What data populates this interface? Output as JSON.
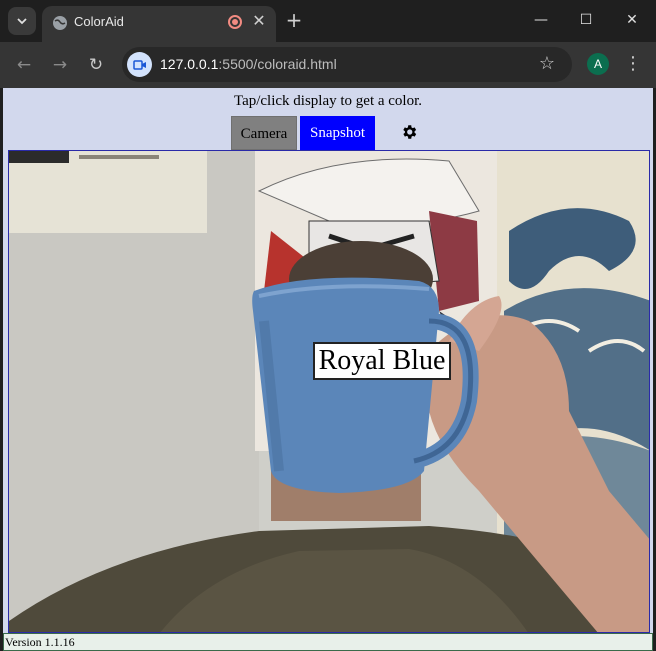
{
  "browser": {
    "tab_title": "ColorAid",
    "url_host": "127.0.0.1",
    "url_rest": ":5500/coloraid.html",
    "profile_initial": "A"
  },
  "app": {
    "instruction": "Tap/click display to get a color.",
    "camera_label": "Camera",
    "snapshot_label": "Snapshot",
    "detected_color": "Royal Blue",
    "version": "Version 1.1.16"
  },
  "colors": {
    "page_bg": "#d2d8ed",
    "camera_button": "#808080",
    "snapshot_button": "#0000ff",
    "mug": "#5b86b9"
  }
}
